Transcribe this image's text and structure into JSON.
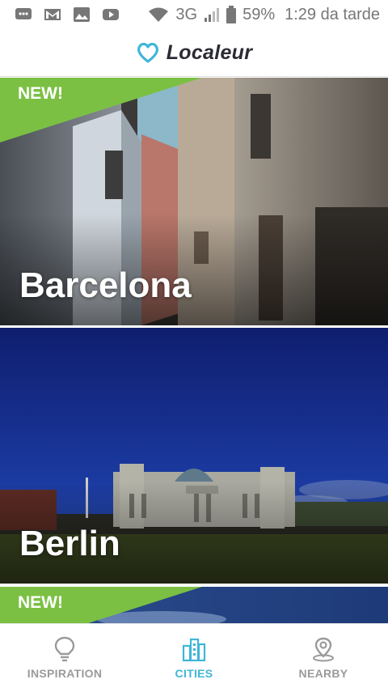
{
  "status": {
    "network": "3G",
    "battery": "59%",
    "time": "1:29 da tarde",
    "icons": [
      "messages-icon",
      "gmail-icon",
      "gallery-icon",
      "youtube-icon",
      "wifi-icon",
      "signal-icon",
      "battery-icon"
    ]
  },
  "header": {
    "brand": "Localeur",
    "logo_icon": "heart-logo-icon"
  },
  "colors": {
    "accent": "#3fb6d8",
    "badge_green": "#7bc043",
    "nav_inactive": "#9a9a9a"
  },
  "cards": [
    {
      "city": "Barcelona",
      "badge": "NEW!"
    },
    {
      "city": "Berlin",
      "badge": ""
    },
    {
      "city": "",
      "badge": "NEW!"
    }
  ],
  "nav": {
    "items": [
      {
        "label": "INSPIRATION",
        "icon": "lightbulb-icon",
        "active": false
      },
      {
        "label": "CITIES",
        "icon": "buildings-icon",
        "active": true
      },
      {
        "label": "NEARBY",
        "icon": "location-pin-icon",
        "active": false
      }
    ]
  }
}
